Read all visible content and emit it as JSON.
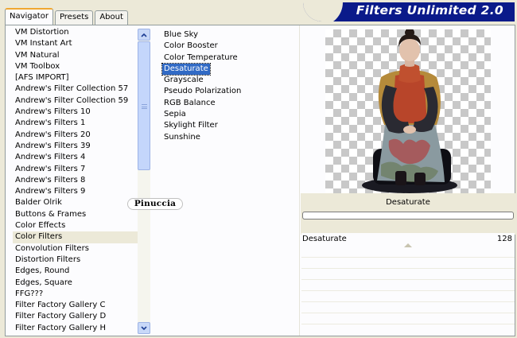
{
  "app": {
    "title": "Filters Unlimited 2.0"
  },
  "tabs": [
    {
      "label": "Navigator",
      "active": true
    },
    {
      "label": "Presets",
      "active": false
    },
    {
      "label": "About",
      "active": false
    }
  ],
  "categories": {
    "selected": "Color Filters",
    "items": [
      "VM Distortion",
      "VM Instant Art",
      "VM Natural",
      "VM Toolbox",
      "[AFS IMPORT]",
      "Andrew's Filter Collection 57",
      "Andrew's Filter Collection 59",
      "Andrew's Filters 10",
      "Andrew's Filters 1",
      "Andrew's Filters 20",
      "Andrew's Filters 39",
      "Andrew's Filters 4",
      "Andrew's Filters 7",
      "Andrew's Filters 8",
      "Andrew's Filters 9",
      "Balder Olrik",
      "Buttons & Frames",
      "Color Effects",
      "Color Filters",
      "Convolution Filters",
      "Distortion Filters",
      "Edges, Round",
      "Edges, Square",
      "FFG???",
      "Filter Factory Gallery C",
      "Filter Factory Gallery D",
      "Filter Factory Gallery H"
    ]
  },
  "filters": {
    "selected": "Desaturate",
    "items": [
      "Blue Sky",
      "Color Booster",
      "Color Temperature",
      "Desaturate",
      "Grayscale",
      "Pseudo Polarization",
      "RGB Balance",
      "Sepia",
      "Skylight Filter",
      "Sunshine"
    ]
  },
  "watermark": "Pinuccia",
  "current_filter": {
    "name": "Desaturate"
  },
  "parameter": {
    "label": "Desaturate",
    "value": "128",
    "level": 0.5
  },
  "colors": {
    "banner": "#0a1a8a",
    "selection": "#316ac5",
    "tab_accent": "#f0a731",
    "panel_bg": "#ece9d8"
  },
  "icons": {
    "scroll_up": "chevron-up-icon",
    "scroll_down": "chevron-down-icon"
  }
}
